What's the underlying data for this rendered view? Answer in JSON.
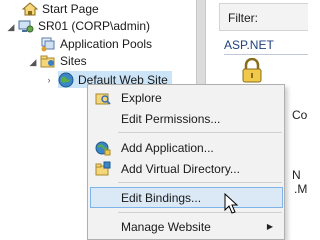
{
  "tree": {
    "start_page": "Start Page",
    "server": "SR01 (CORP\\admin)",
    "app_pools": "Application Pools",
    "sites": "Sites",
    "default_site": "Default Web Site"
  },
  "right_pane": {
    "filter_label": "Filter:",
    "aspnet_label": "ASP.NET",
    "fragment_co": "Co",
    "fragment_dot": ".",
    "fragment_n": "N",
    "fragment_m": ".M"
  },
  "context_menu": {
    "explore": "Explore",
    "edit_permissions": "Edit Permissions...",
    "add_application": "Add Application...",
    "add_virtual_directory": "Add Virtual Directory...",
    "edit_bindings": "Edit Bindings...",
    "manage_website": "Manage Website"
  },
  "colors": {
    "highlight_fill": "#dbe9f7",
    "highlight_border": "#7eb4ea",
    "menu_background": "#f2f2f2"
  },
  "icons": [
    "home-icon",
    "server-icon",
    "app-pools-icon",
    "sites-folder-icon",
    "globe-icon",
    "explore-folder-icon",
    "lock-icon",
    "add-application-icon",
    "add-virtual-directory-icon",
    "submenu-arrow-icon",
    "mouse-cursor-icon"
  ]
}
